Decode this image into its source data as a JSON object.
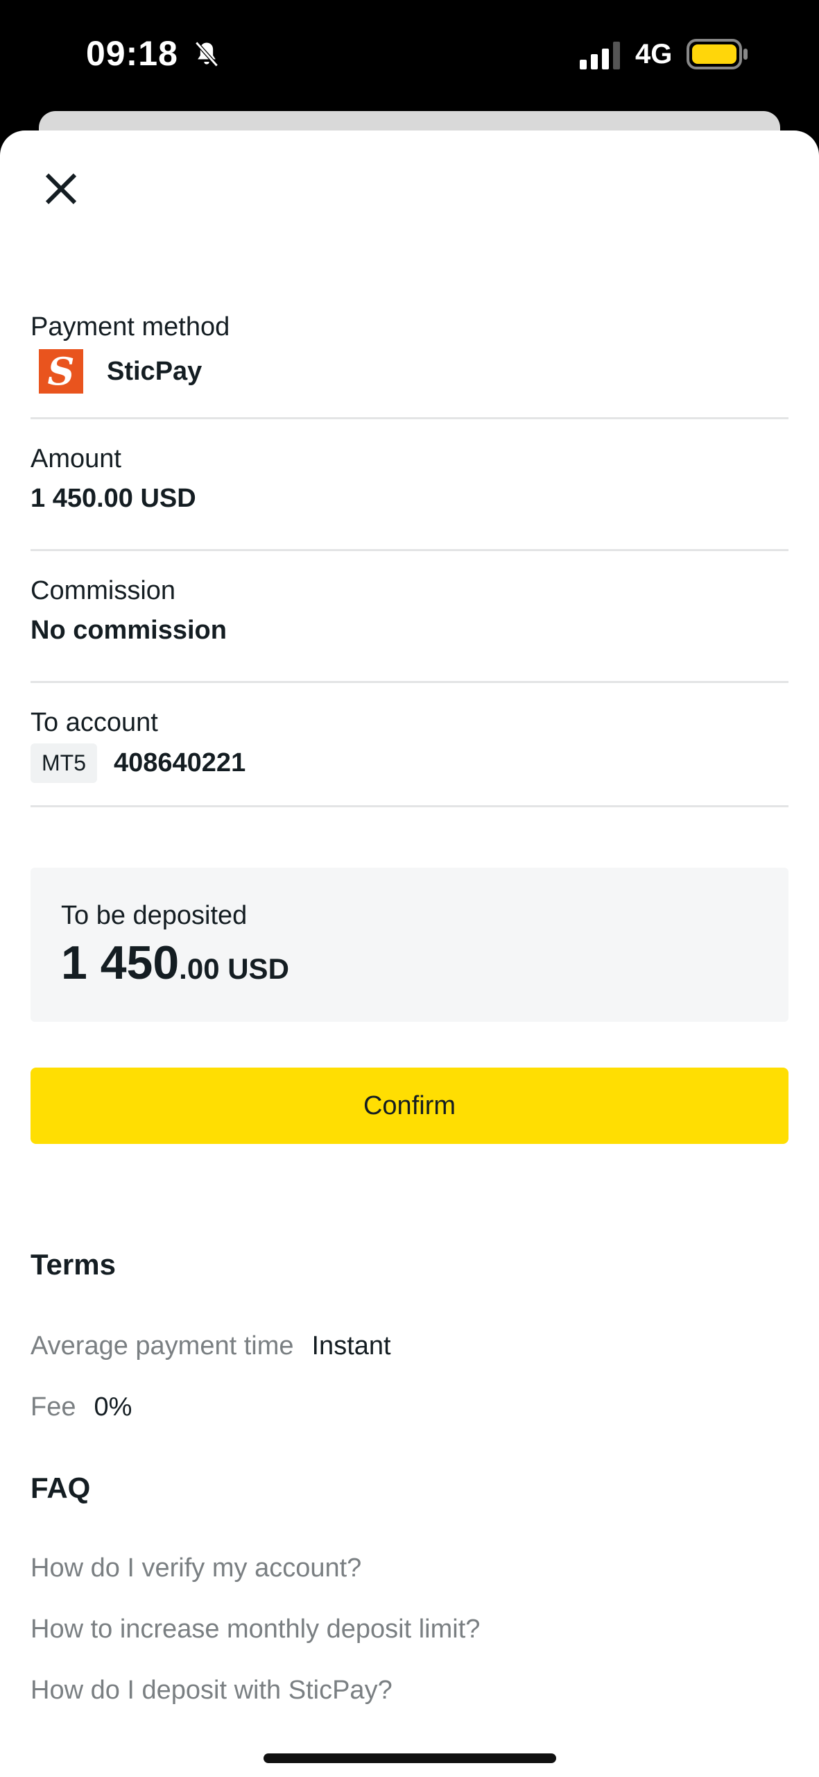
{
  "status_bar": {
    "time": "09:18",
    "network": "4G",
    "icons": [
      "bell-slash-icon",
      "signal-icon",
      "battery-icon"
    ]
  },
  "details": {
    "payment_method": {
      "label": "Payment method",
      "value": "SticPay",
      "logo_letter": "S",
      "logo_color": "#e9541e"
    },
    "amount": {
      "label": "Amount",
      "value": "1 450.00 USD"
    },
    "commission": {
      "label": "Commission",
      "value": "No commission"
    },
    "to_account": {
      "label": "To account",
      "badge": "MT5",
      "number": "408640221"
    }
  },
  "deposit": {
    "label": "To be deposited",
    "amount_major": "1 450",
    "amount_minor": ".00 USD"
  },
  "confirm_label": "Confirm",
  "terms": {
    "title": "Terms",
    "rows": [
      {
        "key": "Average payment time",
        "value": "Instant"
      },
      {
        "key": "Fee",
        "value": "0%"
      }
    ]
  },
  "faq": {
    "title": "FAQ",
    "items": [
      "How do I verify my account?",
      "How to increase monthly deposit limit?",
      "How do I deposit with SticPay?"
    ]
  },
  "colors": {
    "accent": "#ffde02",
    "text": "#141d22",
    "muted": "#7a7f82",
    "panel": "#f5f6f7"
  }
}
